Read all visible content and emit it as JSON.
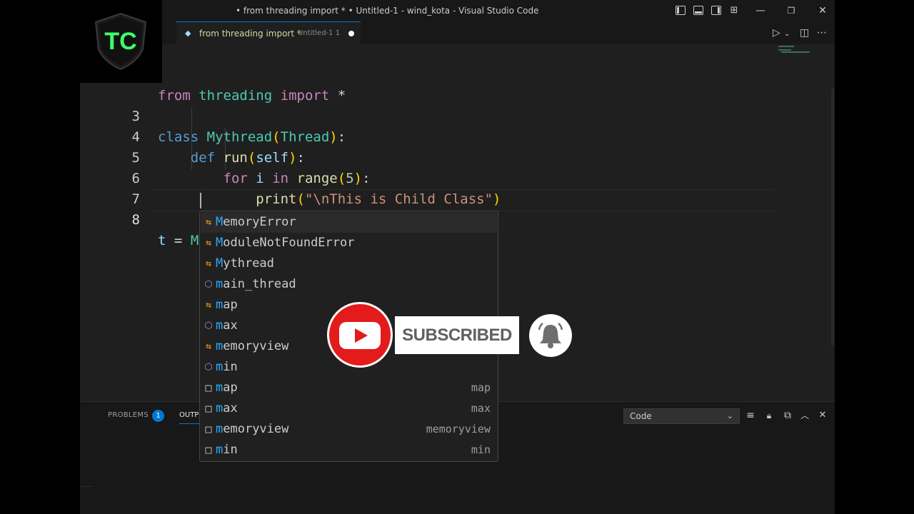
{
  "titlebar": {
    "title": "• from threading import * • Untitled-1 - wind_kota - Visual Studio Code"
  },
  "tab": {
    "name": "from threading import *",
    "sub": "Untitled-1 1"
  },
  "editor": {
    "lines": [
      {
        "number": "",
        "text": "from threading import *"
      },
      {
        "number": "3",
        "text": "class Mythread(Thread):"
      },
      {
        "number": "4",
        "text": "    def run(self):"
      },
      {
        "number": "5",
        "text": "        for i in range(5):"
      },
      {
        "number": "6",
        "text": "            print(\"\\nThis is Child Class\")"
      },
      {
        "number": "7",
        "text": ""
      },
      {
        "number": "8",
        "text": "t = M"
      }
    ],
    "tokens": {
      "l1": {
        "from": "from",
        "mod": "threading",
        "import": "import",
        "star": "*"
      },
      "l3": {
        "class": "class",
        "name": "Mythread",
        "p1": "(",
        "base": "Thread",
        "p2": ")",
        "colon": ":"
      },
      "l4": {
        "def": "def",
        "name": "run",
        "p1": "(",
        "self": "self",
        "p2": ")",
        "colon": ":"
      },
      "l5": {
        "for": "for",
        "var": "i",
        "in": "in",
        "fn": "range",
        "p1": "(",
        "num": "5",
        "p2": ")",
        "colon": ":"
      },
      "l6": {
        "fn": "print",
        "p1": "(",
        "str": "\"\\nThis is Child Class\"",
        "p2": ")"
      },
      "l8": {
        "var": "t",
        "eq": "=",
        "typed": "M"
      }
    }
  },
  "suggest": {
    "items": [
      {
        "icon": "class-icon",
        "match": "M",
        "rest": "emoryError",
        "detail": ""
      },
      {
        "icon": "class-icon",
        "match": "M",
        "rest": "oduleNotFoundError",
        "detail": ""
      },
      {
        "icon": "class-icon",
        "match": "M",
        "rest": "ythread",
        "detail": ""
      },
      {
        "icon": "function-icon",
        "match": "m",
        "rest": "ain_thread",
        "detail": ""
      },
      {
        "icon": "class-icon",
        "match": "m",
        "rest": "ap",
        "detail": ""
      },
      {
        "icon": "function-icon",
        "match": "m",
        "rest": "ax",
        "detail": ""
      },
      {
        "icon": "class-icon",
        "match": "m",
        "rest": "emoryview",
        "detail": ""
      },
      {
        "icon": "function-icon",
        "match": "m",
        "rest": "in",
        "detail": ""
      },
      {
        "icon": "keyword-icon",
        "match": "m",
        "rest": "ap",
        "detail": "map"
      },
      {
        "icon": "keyword-icon",
        "match": "m",
        "rest": "ax",
        "detail": "max"
      },
      {
        "icon": "keyword-icon",
        "match": "m",
        "rest": "emoryview",
        "detail": "memoryview"
      },
      {
        "icon": "keyword-icon",
        "match": "m",
        "rest": "in",
        "detail": "min"
      }
    ]
  },
  "panel": {
    "problems_label": "PROBLEMS",
    "problems_count": "1",
    "output_label": "OUTP",
    "output_channel": "Code"
  },
  "overlay": {
    "logo_text": "TC",
    "subscribe_label": "SUBSCRIBED"
  },
  "colors": {
    "accent": "#0078d4",
    "youtube_red": "#e31b1b",
    "logo_green": "#3dff6a"
  }
}
